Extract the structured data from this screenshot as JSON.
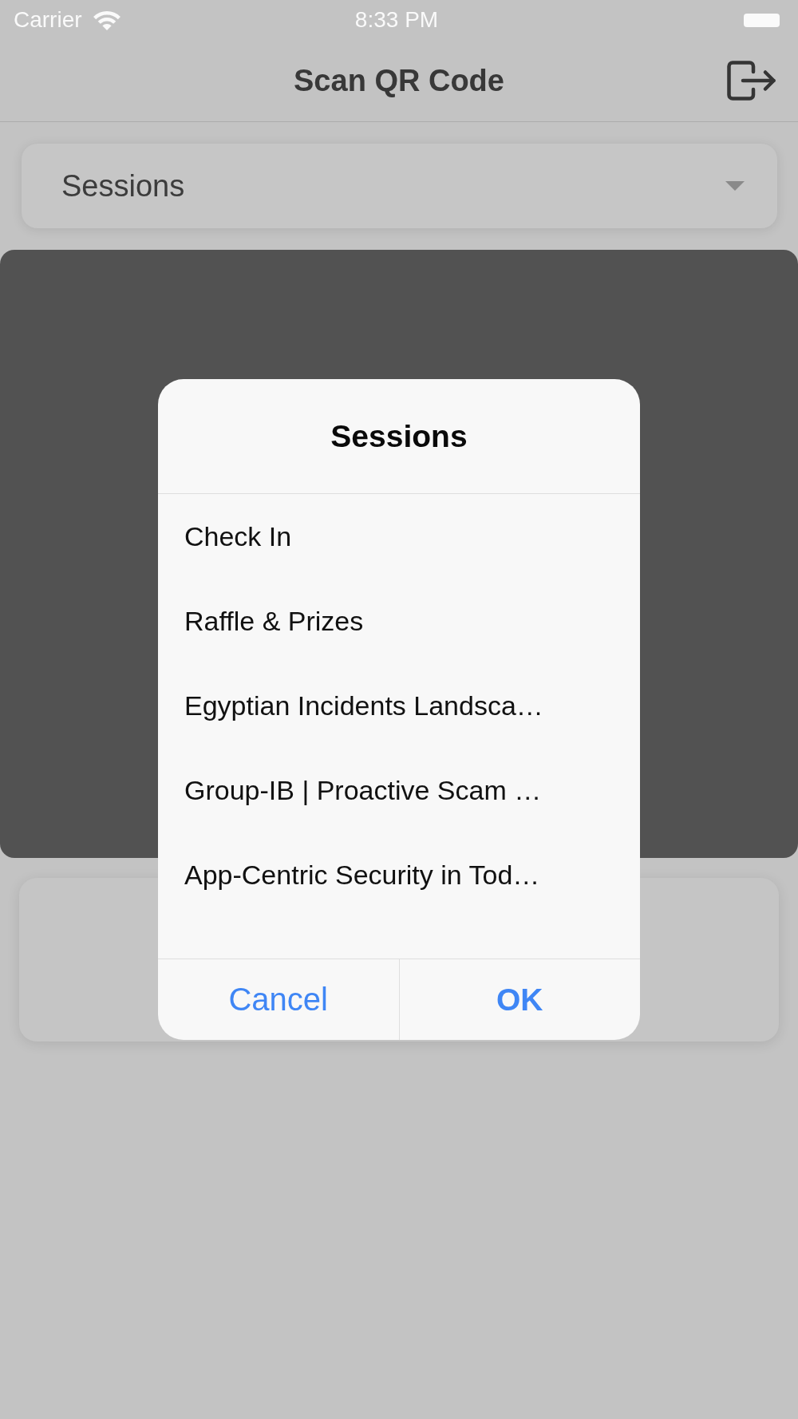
{
  "status_bar": {
    "carrier": "Carrier",
    "time": "8:33 PM"
  },
  "nav_bar": {
    "title": "Scan QR Code"
  },
  "session_dropdown": {
    "label": "Sessions"
  },
  "dialog": {
    "title": "Sessions",
    "options": [
      {
        "label": "Check In",
        "selected": false
      },
      {
        "label": "Raffle & Prizes",
        "selected": false
      },
      {
        "label": "Egyptian Incidents Landsca…",
        "selected": false
      },
      {
        "label": "Group-IB | Proactive Scam …",
        "selected": false
      },
      {
        "label": "App-Centric Security in Tod…",
        "selected": false
      }
    ],
    "buttons": [
      {
        "label": "Cancel",
        "kind": "cancel"
      },
      {
        "label": "OK",
        "kind": "confirm"
      }
    ]
  }
}
